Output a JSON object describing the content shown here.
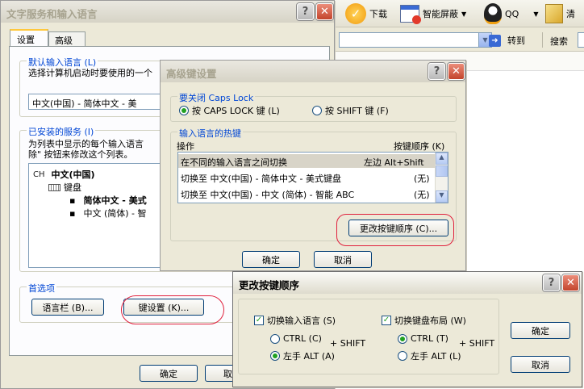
{
  "browser": {
    "toolbar": [
      {
        "icon": "download-icon",
        "label": "下载"
      },
      {
        "icon": "popup-block-icon",
        "label": "智能屏蔽"
      },
      {
        "icon": "qq-penguin-icon",
        "label": "QQ"
      },
      {
        "icon": "clean-icon",
        "label": "清"
      }
    ],
    "go_label": "转到",
    "search_label": "搜索"
  },
  "main_dialog": {
    "title": "文字服务和输入语言",
    "tabs": [
      "设置",
      "高级"
    ],
    "default_lang_group": "默认输入语言 (L)",
    "default_lang_desc": "选择计算机启动时要使用的一个",
    "default_lang_value": "中文(中国) - 简体中文 - 美",
    "installed_group": "已安装的服务 (I)",
    "installed_desc_1": "为列表中显示的每个输入语言",
    "installed_desc_2": "除\" 按钮来修改这个列表。",
    "tree_lang_code": "CH",
    "tree_lang": "中文(中国)",
    "tree_keyboard": "键盘",
    "tree_item_1": "简体中文 - 美式",
    "tree_item_2": "中文 (简体) - 智",
    "prefs_group": "首选项",
    "language_bar_btn": "语言栏 (B)...",
    "key_settings_btn": "键设置 (K)...",
    "ok_btn": "确定",
    "cancel_btn_partial": "取"
  },
  "adv_dialog": {
    "title": "高级键设置",
    "caps_group": "要关闭 Caps Lock",
    "caps_opt": "按 CAPS LOCK 键 (L)",
    "shift_opt": "按 SHIFT 键 (F)",
    "hotkey_group": "输入语言的热键",
    "col_action": "操作",
    "col_keys": "按键顺序 (K)",
    "rows": [
      {
        "action": "在不同的输入语言之间切换",
        "keys": "左边 Alt+Shift"
      },
      {
        "action": "切换至 中文(中国) - 简体中文 - 美式键盘",
        "keys": "(无)"
      },
      {
        "action": "切换至 中文(中国) - 中文 (简体) - 智能 ABC",
        "keys": "(无)"
      }
    ],
    "change_seq_btn": "更改按键顺序 (C)...",
    "ok_btn": "确定",
    "cancel_btn": "取消"
  },
  "seq_dialog": {
    "title": "更改按键顺序",
    "switch_lang": "切换输入语言 (S)",
    "switch_layout": "切换键盘布局 (W)",
    "ctrl_c": "CTRL (C)",
    "left_alt_a": "左手 ALT (A)",
    "ctrl_t": "CTRL (T)",
    "left_alt": "左手 ALT (L)",
    "plus_shift": "+ SHIFT",
    "ok_btn": "确定",
    "cancel_btn": "取消"
  }
}
